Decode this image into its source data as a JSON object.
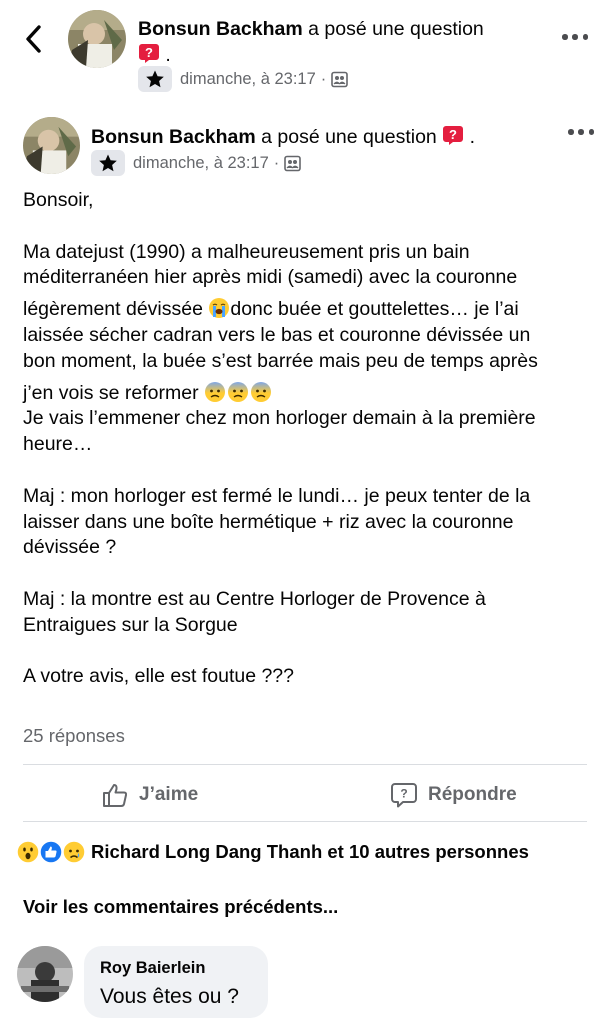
{
  "header": {
    "author": "Bonsun Backham",
    "action_text": "a posé une question",
    "trailing": ".",
    "time": "dimanche, à 23:17",
    "dot": "·"
  },
  "post": {
    "author": "Bonsun Backham",
    "action_text": "a posé une question",
    "trailing": ".",
    "time": "dimanche, à 23:17",
    "dot": "·",
    "body": {
      "greeting": "Bonsoir,",
      "p1_line1": "Ma datejust (1990) a malheureusement pris un bain",
      "p1_line2": "méditerranéen hier après midi (samedi) avec la couronne",
      "p1_line3": "légèrement dévissée",
      "p1_line3b": "donc buée et gouttelettes… je l’ai",
      "p1_line4": "laissée sécher cadran vers le bas et couronne dévissée un",
      "p1_line5": "bon moment, la buée s’est barrée mais peu de temps après",
      "p1_line6": "j’en vois se reformer",
      "p2_line1": "Je vais l’emmener chez mon horloger demain à la première",
      "p2_line2": "heure…",
      "p3_line1": "Maj : mon horloger est fermé le lundi… je peux tenter de la",
      "p3_line2": "laisser dans une boîte hermétique + riz avec la couronne",
      "p3_line3": "dévissée ?",
      "p4_line1": "Maj : la montre est au Centre Horloger de Provence à",
      "p4_line2": "Entraigues sur la Sorgue",
      "p5_line1": "A votre avis, elle est foutue ???"
    },
    "replies_count": "25 réponses",
    "like_label": "J’aime",
    "reply_label": "Répondre",
    "reactions_text": "Richard Long Dang Thanh et 10 autres personnes",
    "view_previous": "Voir les commentaires précédents..."
  },
  "comment": {
    "author": "Roy Baierlein",
    "text": "Vous êtes ou ?"
  },
  "colors": {
    "text": "#050505",
    "secondary": "#65676b",
    "question_badge": "#e41e3f",
    "like_blue": "#1877f2",
    "bubble_bg": "#f0f2f5",
    "badge_bg": "#e4e6eb"
  },
  "icons": [
    "chevron-left-icon",
    "question-badge-icon",
    "star-icon",
    "audience-group-icon",
    "more-icon",
    "like-icon",
    "reply-icon",
    "wow-reaction-icon",
    "like-reaction-icon",
    "sad-reaction-icon",
    "loudly-crying-emoji",
    "fearful-emoji"
  ]
}
